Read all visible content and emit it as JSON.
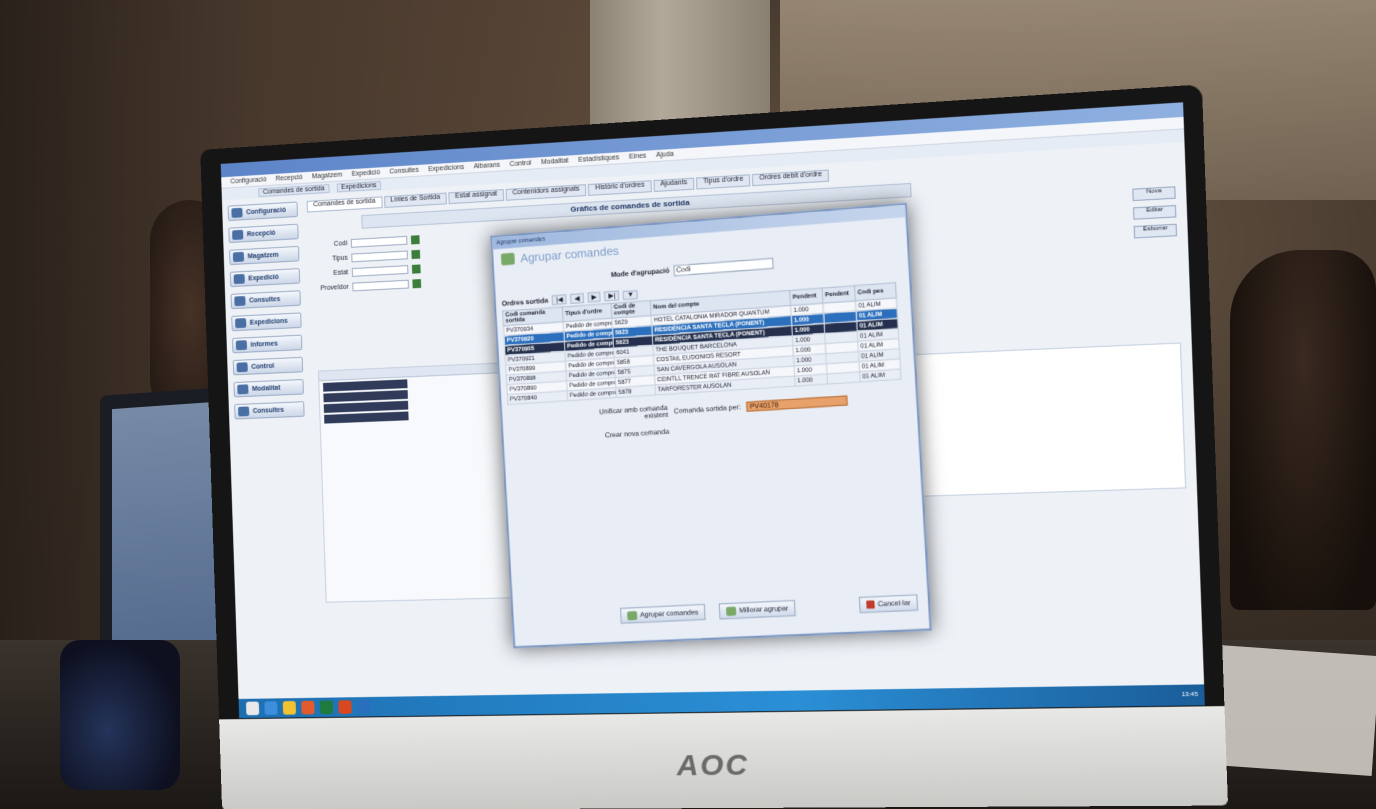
{
  "app": {
    "menus": [
      "Configuració",
      "Recepció",
      "Magatzem",
      "Expedició",
      "Consultes",
      "Expedicions",
      "Albarans",
      "Control",
      "Modalitat",
      "Estadístiques",
      "Eines",
      "Ajuda"
    ],
    "tabs": [
      "Comandes de sortida",
      "Línies de Sortida",
      "Estat assignat",
      "Contenidors assignats",
      "Històric d'ordres",
      "Ajudants",
      "Tipus d'ordre",
      "Ordres debit d'ordre"
    ],
    "page_title": "Gràfics de comandes de sortida",
    "sidebar": [
      "Configuració",
      "Recepció",
      "Magatzem",
      "Expedició",
      "Consultes",
      "Expedicions",
      "Informes",
      "Control",
      "Modalitat",
      "Consultes"
    ],
    "filters": [
      "Codi",
      "Tipus",
      "Estat",
      "Proveïdor"
    ],
    "right_buttons": [
      "Nova",
      "Editar",
      "Esborrar"
    ]
  },
  "dialog": {
    "window_title": "Agrupar comandes",
    "header": "Agrupar comandes",
    "mode_label": "Mode d'agrupació",
    "mode_value": "Codi",
    "nav_label": "Ordres sortida",
    "columns": [
      "Codi comanda sortida",
      "Tipus d'ordre",
      "Codi de compte",
      "Nom del compte",
      "Pendent",
      "Pendent",
      "Codi pes"
    ],
    "rows": [
      {
        "code": "PV370934",
        "type": "Pedido de compra",
        "account": "5629",
        "name": "HOTEL CATALONIA MIRADOR QUANTUM",
        "p1": "1.000",
        "p2": "",
        "unit": "01 ALIM"
      },
      {
        "code": "PV370920",
        "type": "Pedido de compra",
        "account": "5823",
        "name": "RESIDÈNCIA SANTA TECLA (PONENT)",
        "p1": "1.000",
        "p2": "",
        "unit": "01 ALIM"
      },
      {
        "code": "PV370905",
        "type": "Pedido de compra",
        "account": "5823",
        "name": "RESIDÈNCIA SANTA TECLA (PONENT)",
        "p1": "1.000",
        "p2": "",
        "unit": "01 ALIM"
      },
      {
        "code": "PV370921",
        "type": "Pedido de compra",
        "account": "6041",
        "name": "THE BOUQUET BARCELONA",
        "p1": "1.000",
        "p2": "",
        "unit": "01 ALIM"
      },
      {
        "code": "PV370899",
        "type": "Pedido de compra",
        "account": "5858",
        "name": "COSTAIL EUDONIOS RESORT",
        "p1": "1.000",
        "p2": "",
        "unit": "01 ALIM"
      },
      {
        "code": "PV370898",
        "type": "Pedido de compra",
        "account": "5875",
        "name": "SAN CAVERGOLA AUSOLAN",
        "p1": "1.000",
        "p2": "",
        "unit": "01 ALIM"
      },
      {
        "code": "PV370890",
        "type": "Pedido de compra",
        "account": "5877",
        "name": "CEINTLL TRENCE RAT FIBRE AUSOLAN",
        "p1": "1.000",
        "p2": "",
        "unit": "01 ALIM"
      },
      {
        "code": "PV370840",
        "type": "Pedido de compra",
        "account": "5878",
        "name": "TARFORESTER AUSOLAN",
        "p1": "1.000",
        "p2": "",
        "unit": "01 ALIM"
      }
    ],
    "field_unify": "Unificar amb comanda existent",
    "field_order": "Comanda sortida per:",
    "order_value": "PV40178",
    "field_new": "Crear nova comanda",
    "btn_group": "Agrupar comandes",
    "btn_reset": "Millorar agrupar",
    "btn_cancel": "Cancel·lar"
  },
  "monitor": {
    "brand": "AOC"
  },
  "taskbar": {
    "clock": "13:45"
  }
}
